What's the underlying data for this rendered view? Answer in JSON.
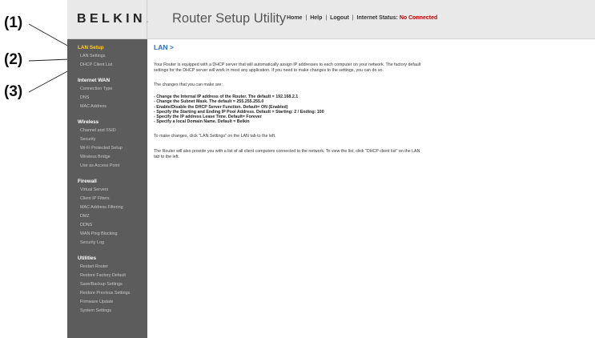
{
  "callouts": [
    "(1)",
    "(2)",
    "(3)"
  ],
  "header": {
    "logo": "BELKIN",
    "logo_dot": ".",
    "title": "Router Setup Utility",
    "links": {
      "home": "Home",
      "help": "Help",
      "logout": "Logout",
      "sep": "|"
    },
    "status_label": "Internet Status:",
    "status_value": "No Connected"
  },
  "sidebar": {
    "lan": {
      "title": "LAN Setup",
      "items": [
        "LAN Settings",
        "DHCP Client List"
      ]
    },
    "wan": {
      "title": "Internet WAN",
      "items": [
        "Connection Type",
        "DNS",
        "MAC Address"
      ]
    },
    "wireless": {
      "title": "Wireless",
      "items": [
        "Channel and SSID",
        "Security",
        "Wi-Fi Protected Setup",
        "Wireless Bridge",
        "Use as Access Point"
      ]
    },
    "firewall": {
      "title": "Firewall",
      "items": [
        "Virtual Servers",
        "Client IP Filters",
        "MAC Address Filtering",
        "DMZ",
        "DDNS",
        "WAN Ping Blocking",
        "Security Log"
      ]
    },
    "utilities": {
      "title": "Utilities",
      "items": [
        "Restart Router",
        "Restore Factory Default",
        "Save/Backup Settings",
        "Restore Previous Settings",
        "Firmware Update",
        "System Settings"
      ]
    }
  },
  "main": {
    "heading": "LAN >",
    "intro": "Your Router is equipped with a DHCP server that will automatically assign IP addresses to each computer on your network. The factory default settings for the DHCP server will work in most any application. If you need to make changes to the settings, you can do so.",
    "changes_intro": "The changes that you can make are:",
    "changes": [
      "- Change the Internal IP address of the Router. The default = 192.168.2.1",
      "- Change the Subnet Mask. The default = 255.255.255.0",
      "- Enable/Disable the DHCP Server Function. Default= ON (Enabled)",
      "- Specify the Starting and Ending IP Pool Address. Default = Starting: 2 / Ending: 100",
      "- Specify the IP address Lease Time. Default= Forever",
      "- Specify a local Domain Name. Default = Belkin"
    ],
    "make_changes": "To make changes, click \"LAN Settings\" on the LAN tab to the left.",
    "client_list": "The Router will also provide you with a list of all client computers connected to the network. To view the list, click \"DHCP client list\" on the LAN tab to the left."
  }
}
